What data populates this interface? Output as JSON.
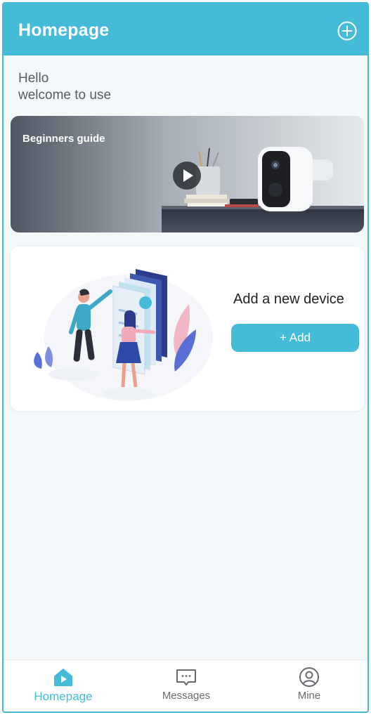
{
  "colors": {
    "accent": "#45bcd7",
    "background": "#f4f8fb",
    "text": "#222222",
    "muted": "#666b70"
  },
  "header": {
    "title": "Homepage",
    "add_icon": "plus-circle-icon"
  },
  "greeting": {
    "line1": "Hello",
    "line2": "welcome to use"
  },
  "banner": {
    "label": "Beginners guide",
    "play_icon": "play-icon"
  },
  "add_card": {
    "title": "Add a new device",
    "button_label": "+ Add"
  },
  "tabbar": {
    "items": [
      {
        "label": "Homepage",
        "icon": "home-icon",
        "active": true
      },
      {
        "label": "Messages",
        "icon": "message-icon",
        "active": false
      },
      {
        "label": "Mine",
        "icon": "user-icon",
        "active": false
      }
    ]
  }
}
